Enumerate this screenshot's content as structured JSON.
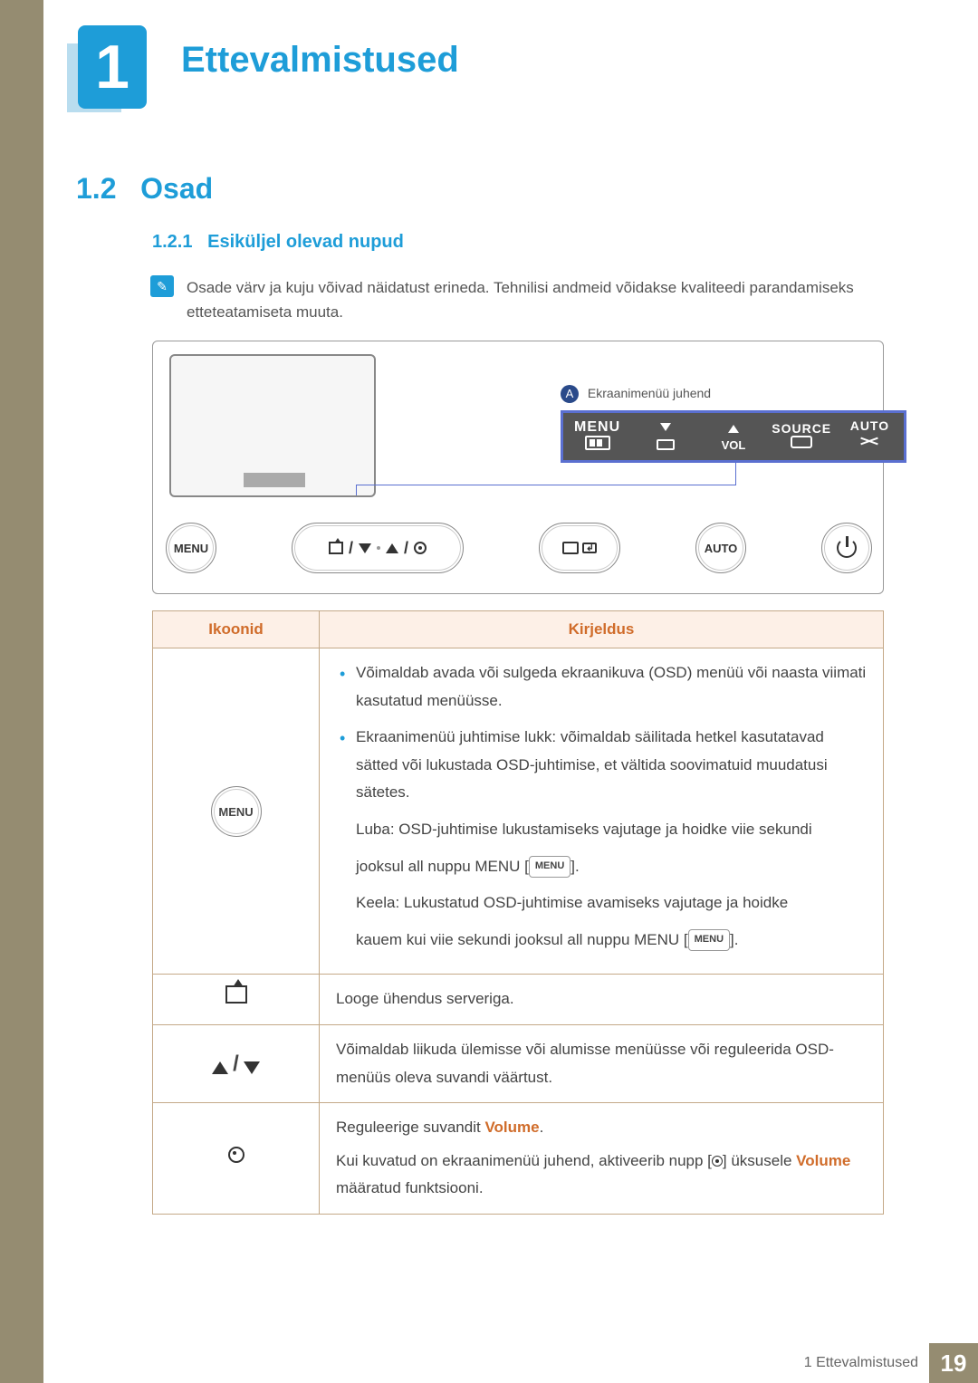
{
  "chapter": {
    "number": "1",
    "title": "Ettevalmistused"
  },
  "section": {
    "number": "1.2",
    "title": "Osad"
  },
  "subsection": {
    "number": "1.2.1",
    "title": "Esiküljel olevad nupud"
  },
  "note": "Osade värv ja kuju võivad näidatust erineda. Tehnilisi andmeid võidakse kvaliteedi parandamiseks etteteatamiseta muuta.",
  "guide": {
    "marker": "A",
    "label": "Ekraanimenüü juhend"
  },
  "panel": {
    "menu": "MENU",
    "vol": "VOL",
    "source": "SOURCE",
    "auto": "AUTO"
  },
  "buttons": {
    "menu": "MENU",
    "auto": "AUTO"
  },
  "table": {
    "headers": {
      "icons": "Ikoonid",
      "desc": "Kirjeldus"
    },
    "menu_label": "MENU",
    "row_menu": {
      "li1": "Võimaldab avada või sulgeda ekraanikuva (OSD) menüü või naasta viimati kasutatud menüüsse.",
      "li2": "Ekraanimenüü juhtimise lukk: võimaldab säilitada hetkel kasutatavad sätted või lukustada OSD-juhtimise, et vältida soovimatuid muudatusi sätetes.",
      "luba_pre": "Luba: OSD-juhtimise lukustamiseks vajutage ja hoidke viie sekundi",
      "luba_post_pre": "jooksul all nuppu MENU [",
      "luba_post_post": "].",
      "keela_pre": "Keela: Lukustatud OSD-juhtimise avamiseks vajutage ja hoidke",
      "keela_post_pre": "kauem kui viie sekundi jooksul all nuppu MENU [",
      "keela_post_post": "].",
      "menu_inline": "MENU"
    },
    "row_upload": "Looge ühendus serveriga.",
    "row_updown": "Võimaldab liikuda ülemisse või alumisse menüüsse või reguleerida OSD-menüüs oleva suvandi väärtust.",
    "row_target": {
      "l1_pre": "Reguleerige suvandit ",
      "l1_vol": "Volume",
      "l1_post": ".",
      "l2_pre": "Kui kuvatud on ekraanimenüü juhend, aktiveerib nupp [",
      "l2_post": "] üksusele ",
      "l2_vol": "Volume",
      "l2_end": " määratud funktsiooni."
    }
  },
  "footer": {
    "chapter_ref": "1 Ettevalmistused",
    "page": "19"
  }
}
